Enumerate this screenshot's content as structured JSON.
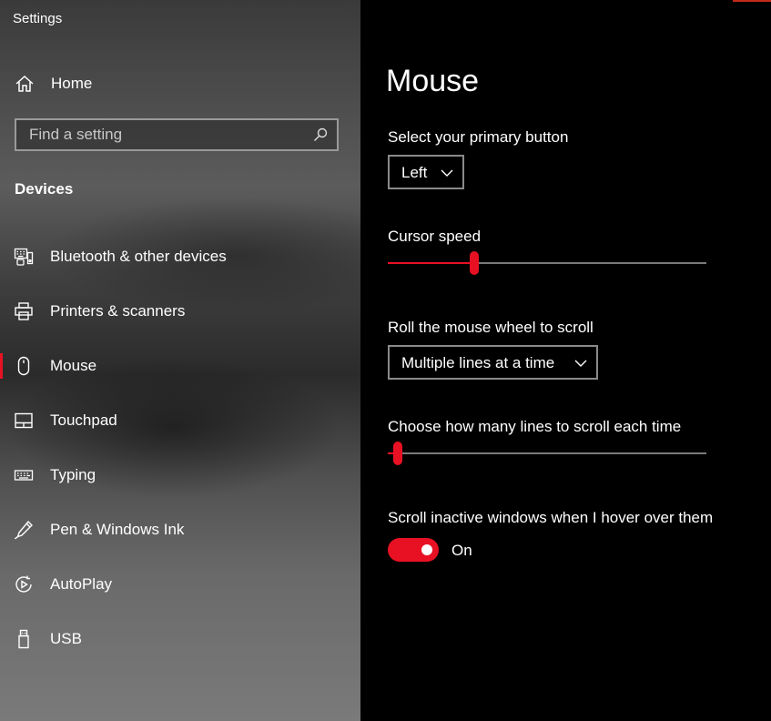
{
  "window": {
    "title": "Settings"
  },
  "sidebar": {
    "home_label": "Home",
    "search_placeholder": "Find a setting",
    "section_title": "Devices",
    "items": [
      {
        "label": "Bluetooth & other devices",
        "icon": "bluetooth-devices-icon"
      },
      {
        "label": "Printers & scanners",
        "icon": "printer-icon"
      },
      {
        "label": "Mouse",
        "icon": "mouse-icon",
        "selected": true
      },
      {
        "label": "Touchpad",
        "icon": "touchpad-icon"
      },
      {
        "label": "Typing",
        "icon": "keyboard-icon"
      },
      {
        "label": "Pen & Windows Ink",
        "icon": "pen-icon"
      },
      {
        "label": "AutoPlay",
        "icon": "autoplay-icon"
      },
      {
        "label": "USB",
        "icon": "usb-icon"
      }
    ]
  },
  "main": {
    "title": "Mouse",
    "primary_button": {
      "label": "Select your primary button",
      "value": "Left"
    },
    "cursor_speed": {
      "label": "Cursor speed",
      "value_fraction": 0.27
    },
    "scroll_mode": {
      "label": "Roll the mouse wheel to scroll",
      "value": "Multiple lines at a time"
    },
    "scroll_lines": {
      "label": "Choose how many lines to scroll each time",
      "value_fraction": 0.03
    },
    "inactive_scroll": {
      "label": "Scroll inactive windows when I hover over them",
      "state_label": "On",
      "on": true
    }
  },
  "colors": {
    "accent": "#e81123",
    "background": "#000000",
    "control_border": "#8a8a8a"
  }
}
